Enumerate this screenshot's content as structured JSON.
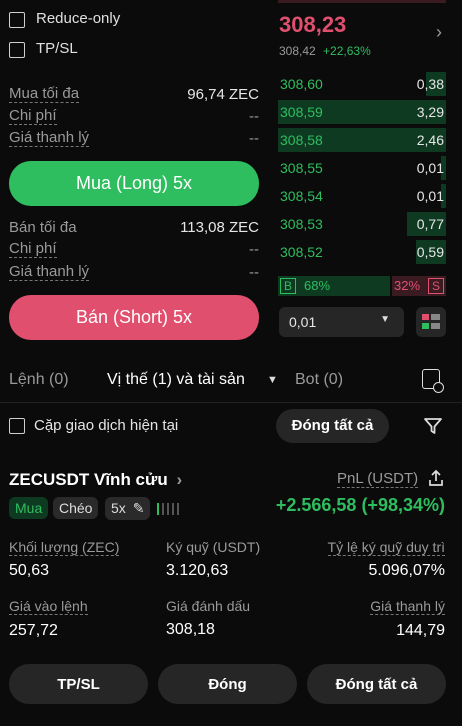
{
  "order_form": {
    "reduce_only_label": "Reduce-only",
    "tpsl_label": "TP/SL",
    "long": {
      "max_label": "Mua tối đa",
      "max_value": "96,74 ZEC",
      "cost_label": "Chi phí",
      "cost_value": "--",
      "liq_label": "Giá thanh lý",
      "liq_value": "--",
      "button": "Mua (Long) 5x"
    },
    "short": {
      "max_label": "Bán tối đa",
      "max_value": "113,08 ZEC",
      "cost_label": "Chi phí",
      "cost_value": "--",
      "liq_label": "Giá thanh lý",
      "liq_value": "--",
      "button": "Bán (Short) 5x"
    }
  },
  "orderbook": {
    "last_price": "308,23",
    "mark_price": "308,42",
    "change": "+22,63%",
    "rows": [
      {
        "price": "308,60",
        "qty": "0,38",
        "depth": 0.12
      },
      {
        "price": "308,59",
        "qty": "3,29",
        "depth": 1.0
      },
      {
        "price": "308,58",
        "qty": "2,46",
        "depth": 1.0
      },
      {
        "price": "308,55",
        "qty": "0,01",
        "depth": 0.03
      },
      {
        "price": "308,54",
        "qty": "0,01",
        "depth": 0.03
      },
      {
        "price": "308,53",
        "qty": "0,77",
        "depth": 0.23
      },
      {
        "price": "308,52",
        "qty": "0,59",
        "depth": 0.18
      }
    ],
    "buy_tag": "B",
    "buy_pct": "68%",
    "sell_pct": "32%",
    "sell_tag": "S",
    "tick_size": "0,01",
    "colors": {
      "up": "#2ebd5f",
      "down": "#e0506e"
    }
  },
  "tabs": {
    "orders": "Lệnh (0)",
    "positions": "Vị thế (1) và tài sản",
    "bot": "Bot (0)"
  },
  "filter": {
    "current_pair_label": "Cặp giao dịch hiện tại",
    "close_all": "Đóng tất cả"
  },
  "position": {
    "symbol": "ZECUSDT Vĩnh cửu",
    "side": "Mua",
    "margin_mode": "Chéo",
    "leverage": "5x",
    "pnl_label": "PnL (USDT)",
    "pnl_value": "+2.566,58 (+98,34%)",
    "size_label": "Khối lượng (ZEC)",
    "size_value": "50,63",
    "margin_label": "Ký quỹ (USDT)",
    "margin_value": "3.120,63",
    "mmr_label": "Tỷ lệ ký quỹ duy trì",
    "mmr_value": "5.096,07%",
    "entry_label": "Giá vào lệnh",
    "entry_value": "257,72",
    "mark_label": "Giá đánh dấu",
    "mark_value": "308,18",
    "liq_label": "Giá thanh lý",
    "liq_value": "144,79"
  },
  "actions": {
    "tpsl": "TP/SL",
    "close": "Đóng",
    "close_all": "Đóng tất cả"
  }
}
